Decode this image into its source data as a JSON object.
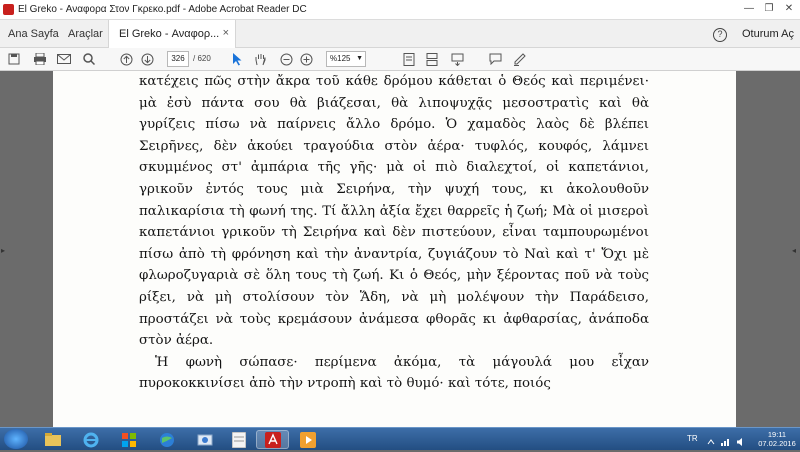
{
  "window": {
    "title": "El Greko - Αναφορα Στον Γκρεκο.pdf - Adobe Acrobat Reader DC",
    "minimize": "—",
    "restore": "❐",
    "close": "✕"
  },
  "menubar": {
    "home": "Ana Sayfa",
    "tools": "Araçlar",
    "tab_label": "El Greko - Αναφορ...",
    "tab_close": "×",
    "help": "?",
    "signin": "Oturum Aç"
  },
  "toolbar": {
    "page_current": "326",
    "page_total": "/ 620",
    "zoom": "%125"
  },
  "document": {
    "paragraph_1": "κατέχεις πῶς στὴν ἄκρα τοῦ κάθε δρόμου κάθεται ὁ Θεός καὶ περιμένει· μὰ ἐσὺ πάντα σου θὰ βιάζεσαι, θὰ λιποψυχᾷς μεσοστρατὶς καὶ θὰ γυρίζεις πίσω νὰ παίρνεις ἄλλο δρόμο. Ὁ χαμαδὸς λαὸς δὲ βλέπει Σειρῆνες, δὲν ἀκούει τραγούδια στὸν ἀέρα· τυφλός, κουφός, λάμνει σκυμμένος στ' ἀμπάρια τῆς γῆς· μὰ οἱ πιὸ διαλεχτοί, οἱ καπετάνιοι, γρικοῦν ἐντός τους μιὰ Σειρήνα, τὴν ψυχή τους, κι ἀκολουθοῦν παλικαρίσια τὴ φωνή της. Τί ἄλλη ἀξία ἔχει θαρρεῖς ἡ ζωή; Μὰ οἱ μισεροὶ καπετάνιοι γρικοῦν τὴ Σειρήνα καὶ δὲν πιστεύουν, εἶναι ταμπουρωμένοι πίσω ἀπὸ τὴ φρόνηση καὶ τὴν ἀναντρία, ζυγιάζουν τὸ Ναὶ καὶ τ' Ὄχι μὲ φλωροζυγαριὰ σὲ ὅλη τους τὴ ζωή. Κι ὁ Θεός, μὴν ξέροντας ποῦ νὰ τοὺς ρίξει, νὰ μὴ στολίσουν τὸν Ἅδη, νὰ μὴ μολέψουν τὴν Παράδεισο, προστάζει νὰ τοὺς κρεμάσουν ἀνάμεσα φθορᾶς κι ἀφθαρσίας, ἀνάποδα στὸν ἀέρα.",
    "paragraph_2": "Ἡ φωνὴ σώπασε· περίμενα ἀκόμα, τὰ μάγουλά μου εἶχαν πυροκοκκινίσει ἀπὸ τὴν ντροπὴ καὶ τὸ θυμό· καὶ τότε, ποιός"
  },
  "taskbar": {
    "language": "TR",
    "time": "19:11",
    "date": "07.02.2016"
  },
  "icons": {
    "app": "acrobat-icon",
    "start": "windows-start-icon"
  },
  "colors": {
    "acrobat_red": "#c8201d",
    "taskbar": "#2a5a92",
    "page": "#fdfdfb",
    "viewport": "#6b6b6b"
  }
}
